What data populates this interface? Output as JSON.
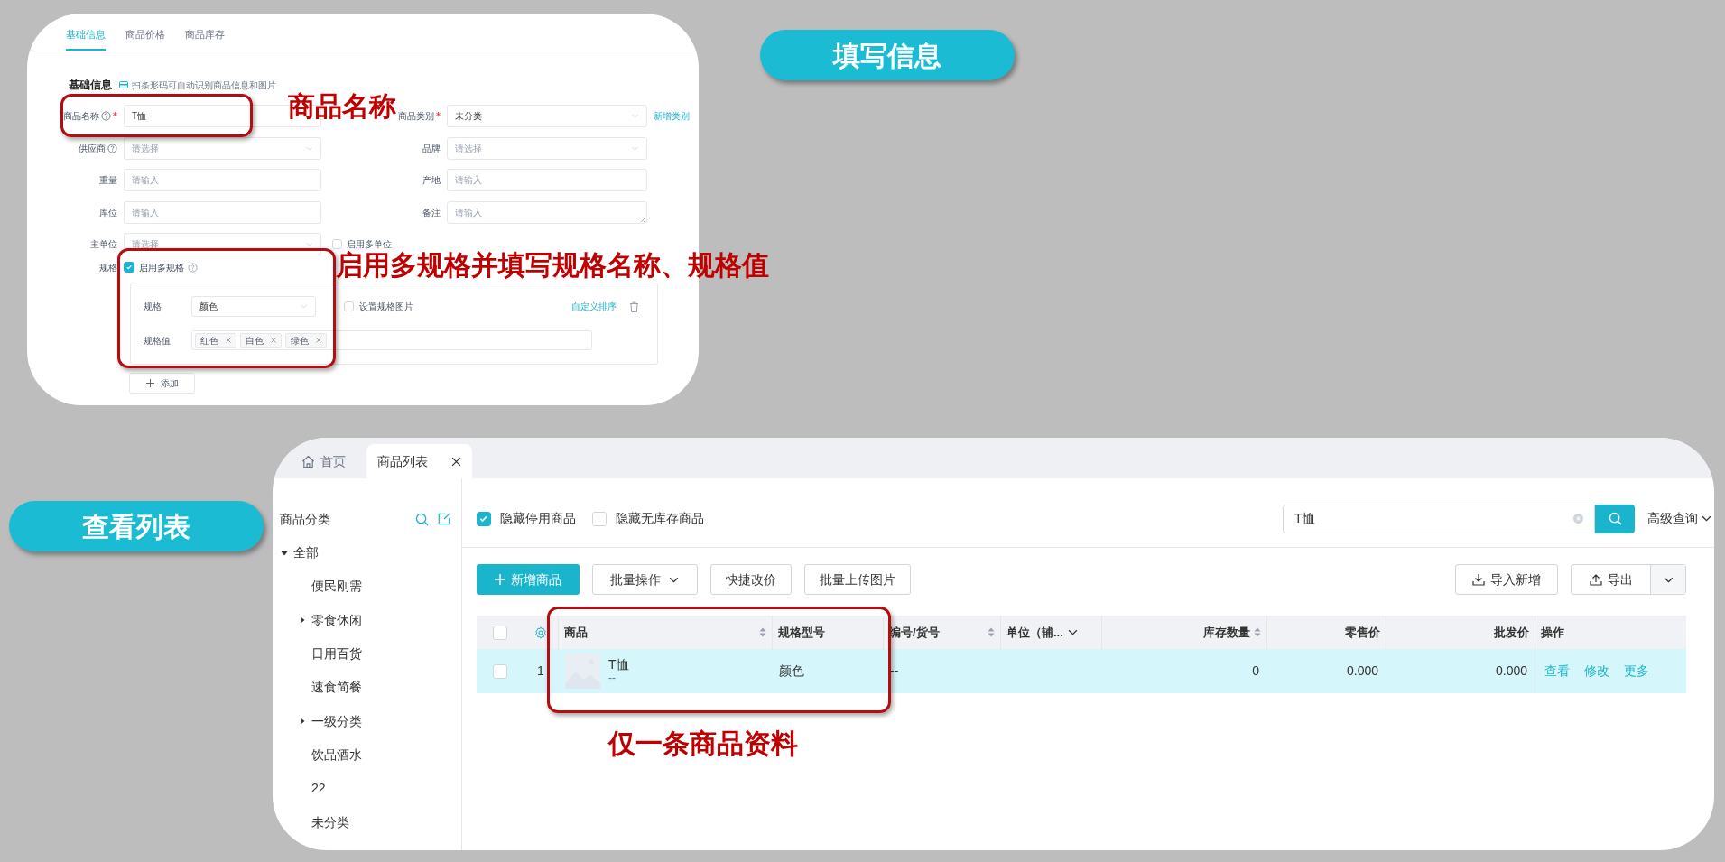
{
  "step_labels": [
    {
      "text": "填写信息"
    },
    {
      "text": "查看列表"
    }
  ],
  "annotations": [
    {
      "text": "商品名称"
    },
    {
      "text": "启用多规格并填写规格名称、规格值"
    },
    {
      "text": "仅一条商品资料"
    }
  ],
  "form_panel": {
    "tabs": [
      {
        "label": "基础信息",
        "selected": true
      },
      {
        "label": "商品价格",
        "selected": false
      },
      {
        "label": "商品库存",
        "selected": false
      }
    ],
    "section_title": "基础信息",
    "scan_hint": "扫条形码可自动识别商品信息和图片",
    "rows": [
      {
        "left": {
          "kind": "input",
          "label": "商品名称",
          "help": true,
          "required": true,
          "value": "T恤"
        },
        "right": {
          "kind": "select",
          "label": "商品类别",
          "required": true,
          "value": "未分类",
          "link": "新增类别"
        }
      },
      {
        "left": {
          "kind": "select",
          "label": "供应商",
          "help": true,
          "placeholder": "请选择"
        },
        "right": {
          "kind": "select",
          "label": "品牌",
          "placeholder": "请选择"
        }
      },
      {
        "left": {
          "kind": "input",
          "label": "重量",
          "placeholder": "请输入"
        },
        "right": {
          "kind": "input",
          "label": "产地",
          "placeholder": "请输入"
        }
      },
      {
        "left": {
          "kind": "input",
          "label": "库位",
          "placeholder": "请输入"
        },
        "right": {
          "kind": "textarea",
          "label": "备注",
          "placeholder": "请输入"
        }
      },
      {
        "left": {
          "kind": "select",
          "label": "主单位",
          "placeholder": "请选择"
        },
        "right": {
          "kind": "checkbox",
          "label": "启用多单位",
          "checked": false
        }
      }
    ],
    "spec": {
      "label": "规格",
      "enable": {
        "label": "启用多规格",
        "checked": true
      },
      "name_label": "规格",
      "name_value": "颜色",
      "image_option": {
        "label": "设置规格图片",
        "checked": false
      },
      "sort_link": "自定义排序",
      "values_label": "规格值",
      "values": [
        "红色",
        "白色",
        "绿色"
      ],
      "add_button": "添加"
    }
  },
  "list_panel": {
    "tabs": [
      {
        "label": "首页",
        "selected": false
      },
      {
        "label": "商品列表",
        "selected": true
      }
    ],
    "sidebar": {
      "title": "商品分类",
      "tree": [
        {
          "label": "全部",
          "kind": "group",
          "expanded": true,
          "children": [
            {
              "label": "便民刚需",
              "kind": "leaf"
            },
            {
              "label": "零食休闲",
              "kind": "group",
              "expanded": false
            },
            {
              "label": "日用百货",
              "kind": "leaf"
            },
            {
              "label": "速食简餐",
              "kind": "leaf"
            },
            {
              "label": "一级分类",
              "kind": "group",
              "expanded": false
            },
            {
              "label": "饮品酒水",
              "kind": "leaf"
            },
            {
              "label": "22",
              "kind": "leaf"
            },
            {
              "label": "未分类",
              "kind": "leaf"
            }
          ]
        }
      ]
    },
    "filters": [
      {
        "label": "隐藏停用商品",
        "checked": true
      },
      {
        "label": "隐藏无库存商品",
        "checked": false
      }
    ],
    "search": {
      "value": "T恤"
    },
    "advanced_query": "高级查询",
    "toolbar_left": [
      {
        "label": "新增商品",
        "kind": "primary"
      },
      {
        "label": "批量操作",
        "kind": "dropdown"
      },
      {
        "label": "快捷改价",
        "kind": "plain"
      },
      {
        "label": "批量上传图片",
        "kind": "plain"
      }
    ],
    "toolbar_right": [
      {
        "label": "导入新增",
        "kind": "import"
      },
      {
        "label": "导出",
        "kind": "split"
      }
    ],
    "table": {
      "select_all_checked": false,
      "columns": [
        {
          "label": "商品"
        },
        {
          "label": "规格型号"
        },
        {
          "label": "编号/货号"
        },
        {
          "label": "单位（辅..."
        },
        {
          "label": "库存数量"
        },
        {
          "label": "零售价"
        },
        {
          "label": "批发价"
        },
        {
          "label": "操作"
        }
      ],
      "rows": [
        {
          "checked": false,
          "highlighted": true,
          "index": "1",
          "cells": [
            {
              "name": "T恤",
              "code": "--"
            },
            "颜色",
            "--",
            "",
            "0",
            "0.000",
            "0.000",
            [
              "查看",
              "修改",
              "更多"
            ]
          ]
        }
      ]
    }
  }
}
